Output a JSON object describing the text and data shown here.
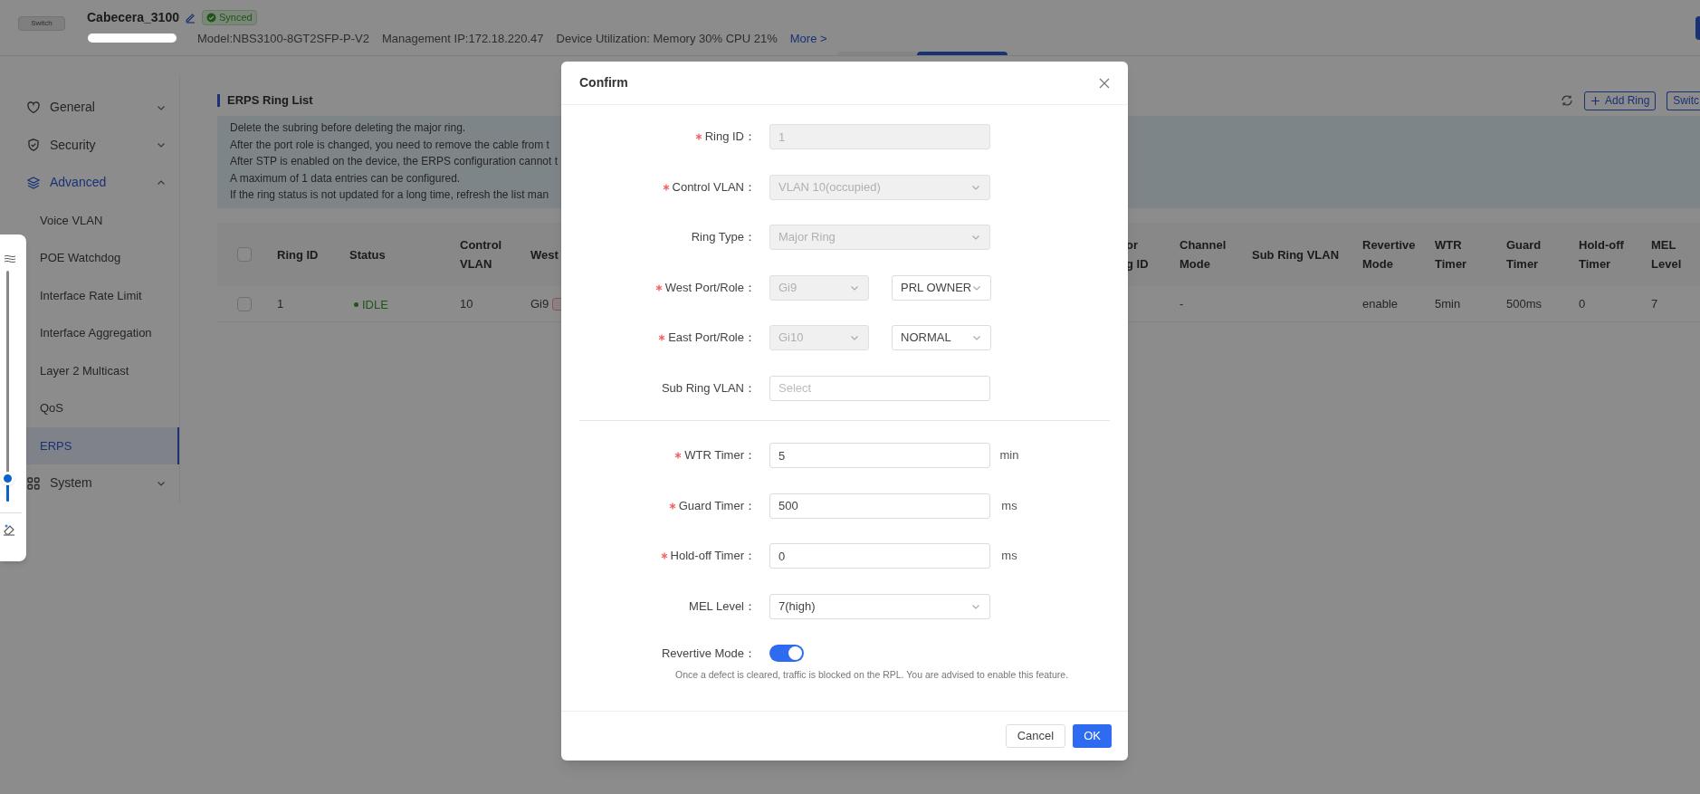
{
  "device": {
    "name": "Cabecera_3100",
    "image_label": "Switch",
    "sync_status": "Synced",
    "details": [
      "Model:NBS3100-8GT2SFP-P-V2",
      "Management IP:172.18.220.47",
      "Device Utilization: Memory 30% CPU 21%"
    ],
    "more_link": "More >"
  },
  "sidebar": {
    "items": [
      {
        "label": "General",
        "expanded": false,
        "selected": false
      },
      {
        "label": "Security",
        "expanded": false,
        "selected": false
      },
      {
        "label": "Advanced",
        "expanded": true,
        "selected": true,
        "children": [
          {
            "label": "Voice VLAN",
            "selected": false
          },
          {
            "label": "POE Watchdog",
            "selected": false
          },
          {
            "label": "Interface Rate Limit",
            "selected": false
          },
          {
            "label": "Interface Aggregation",
            "selected": false
          },
          {
            "label": "Layer 2 Multicast",
            "selected": false
          },
          {
            "label": "QoS",
            "selected": false
          },
          {
            "label": "ERPS",
            "selected": true
          }
        ]
      },
      {
        "label": "System",
        "expanded": false,
        "selected": false
      }
    ]
  },
  "section_title": "ERPS Ring List",
  "toolbar": {
    "add_button": "Add Ring",
    "switch_button": "Switc"
  },
  "notices": [
    "Delete the subring before deleting the major ring.",
    "After the port role is changed, you need to remove the cable from t",
    "After STP is enabled on the device, the ERPS configuration cannot t",
    "A maximum of 1 data entries can be configured.",
    "If the ring status is not updated for a long time, refresh the list man"
  ],
  "table": {
    "header_checked": false,
    "columns": [
      {
        "lines": [
          "Ring ID"
        ],
        "kind": "text"
      },
      {
        "lines": [
          "Status"
        ],
        "kind": "status"
      },
      {
        "lines": [
          "Control",
          "VLAN"
        ],
        "kind": "text"
      },
      {
        "lines": [
          "West"
        ],
        "kind": "port"
      },
      {
        "lines": [
          "or",
          "g ID"
        ],
        "kind": "text"
      },
      {
        "lines": [
          "Channel",
          "Mode"
        ],
        "kind": "text"
      },
      {
        "lines": [
          "Sub Ring VLAN"
        ],
        "kind": "text"
      },
      {
        "lines": [
          "Revertive",
          "Mode"
        ],
        "kind": "text"
      },
      {
        "lines": [
          "WTR",
          "Timer"
        ],
        "kind": "text"
      },
      {
        "lines": [
          "Guard",
          "Timer"
        ],
        "kind": "text"
      },
      {
        "lines": [
          "Hold-off",
          "Timer"
        ],
        "kind": "text"
      },
      {
        "lines": [
          "MEL",
          "Level"
        ],
        "kind": "text"
      }
    ],
    "rows": [
      {
        "checked": false,
        "cells": [
          "1",
          "IDLE",
          "10",
          "Gi9",
          "",
          "-",
          "",
          "enable",
          "5min",
          "500ms",
          "0",
          "7"
        ]
      }
    ]
  },
  "zoom_slider": {
    "level": 0.1
  },
  "dialog": {
    "title": "Confirm",
    "sections": [
      [
        {
          "label": "Ring ID：",
          "required": true,
          "controls": [
            {
              "kind": "input",
              "value": "1",
              "disabled": true
            }
          ]
        },
        {
          "label": "Control VLAN：",
          "required": true,
          "controls": [
            {
              "kind": "select",
              "value": "VLAN 10(occupied)",
              "disabled": true
            }
          ]
        },
        {
          "label": "Ring Type：",
          "required": false,
          "controls": [
            {
              "kind": "select",
              "value": "Major Ring",
              "disabled": true
            }
          ]
        },
        {
          "label": "West Port/Role：",
          "required": true,
          "controls": [
            {
              "kind": "select",
              "value": "Gi9",
              "disabled": true
            },
            {
              "kind": "select",
              "value": "PRL OWNER",
              "disabled": false
            }
          ]
        },
        {
          "label": "East Port/Role：",
          "required": true,
          "controls": [
            {
              "kind": "select",
              "value": "Gi10",
              "disabled": true
            },
            {
              "kind": "select",
              "value": "NORMAL",
              "disabled": false
            }
          ]
        },
        {
          "label": "Sub Ring VLAN：",
          "required": false,
          "controls": [
            {
              "kind": "input",
              "placeholder": "Select",
              "disabled": false
            }
          ]
        }
      ],
      [
        {
          "label": "WTR Timer：",
          "required": true,
          "controls": [
            {
              "kind": "input",
              "value": "5",
              "disabled": false
            }
          ],
          "unit": "min"
        },
        {
          "label": "Guard Timer：",
          "required": true,
          "controls": [
            {
              "kind": "input",
              "value": "500",
              "disabled": false
            }
          ],
          "unit": "ms"
        },
        {
          "label": "Hold-off Timer：",
          "required": true,
          "controls": [
            {
              "kind": "input",
              "value": "0",
              "disabled": false
            }
          ],
          "unit": "ms"
        },
        {
          "label": "MEL Level：",
          "required": false,
          "controls": [
            {
              "kind": "select",
              "value": "7(high)",
              "disabled": false
            }
          ]
        }
      ]
    ],
    "revertive": {
      "label": "Revertive Mode：",
      "on": true,
      "hint": "Once a defect is cleared, traffic is blocked on the RPL. You are advised to enable this feature."
    },
    "buttons": {
      "cancel": "Cancel",
      "ok": "OK"
    }
  }
}
